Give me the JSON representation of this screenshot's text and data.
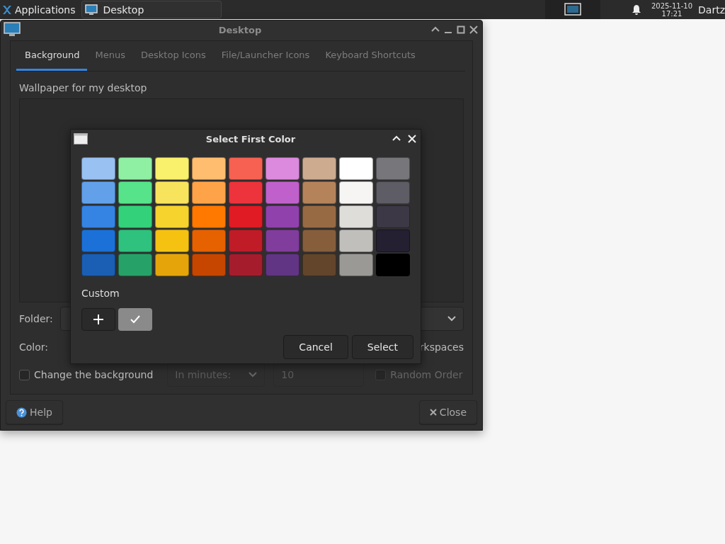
{
  "panel": {
    "menu_label": "Applications",
    "tasks": [
      {
        "label": "Desktop",
        "selected": true
      }
    ],
    "clock": {
      "date": "2025-11-10",
      "time": "17:21"
    },
    "user": "Dartz"
  },
  "window": {
    "title": "Desktop",
    "tabs": [
      {
        "label": "Background",
        "selected": true
      },
      {
        "label": "Menus",
        "selected": false
      },
      {
        "label": "Desktop Icons",
        "selected": false
      },
      {
        "label": "File/Launcher Icons",
        "selected": false
      },
      {
        "label": "Keyboard Shortcuts",
        "selected": false
      }
    ],
    "wallpaper_label": "Wallpaper for my desktop",
    "folder": {
      "label": "Folder:"
    },
    "color": {
      "label": "Color:",
      "apply_text": "rkspaces"
    },
    "change": {
      "label": "Change the background",
      "checked": false,
      "interval": "In minutes:",
      "minutes": "10",
      "random": {
        "label": "Random Order",
        "checked": false,
        "disabled": true
      }
    },
    "buttons": {
      "help": "Help",
      "close": "Close"
    }
  },
  "dialog": {
    "title": "Select First Color",
    "palette": [
      [
        {
          "color": "#99c1f1"
        },
        {
          "color": "#8ff0a4"
        },
        {
          "color": "#f9f06b"
        },
        {
          "color": "#ffbe6f"
        },
        {
          "color": "#f66151"
        },
        {
          "color": "#dc8add"
        },
        {
          "color": "#cdab8f"
        },
        {
          "color": "#ffffff"
        },
        {
          "color": "#77767b"
        }
      ],
      [
        {
          "color": "#62a0ea"
        },
        {
          "color": "#57e389"
        },
        {
          "color": "#f8e45c"
        },
        {
          "color": "#ffa348"
        },
        {
          "color": "#ed333b"
        },
        {
          "color": "#c061cb"
        },
        {
          "color": "#b5835a"
        },
        {
          "color": "#f6f5f4"
        },
        {
          "color": "#5e5c64"
        }
      ],
      [
        {
          "color": "#3584e4"
        },
        {
          "color": "#33d17a"
        },
        {
          "color": "#f6d32d"
        },
        {
          "color": "#ff7800"
        },
        {
          "color": "#e01b24"
        },
        {
          "color": "#9141ac"
        },
        {
          "color": "#986a44"
        },
        {
          "color": "#deddda"
        },
        {
          "color": "#3d3846"
        }
      ],
      [
        {
          "color": "#1c71d8"
        },
        {
          "color": "#2ec27e"
        },
        {
          "color": "#f5c211"
        },
        {
          "color": "#e66100"
        },
        {
          "color": "#c01c28"
        },
        {
          "color": "#813d9c"
        },
        {
          "color": "#865e3c"
        },
        {
          "color": "#c0bfbc"
        },
        {
          "color": "#241f31"
        }
      ],
      [
        {
          "color": "#1a5fb4"
        },
        {
          "color": "#26a269"
        },
        {
          "color": "#e5a50a"
        },
        {
          "color": "#c64600"
        },
        {
          "color": "#a51d2d"
        },
        {
          "color": "#613583"
        },
        {
          "color": "#63452c"
        },
        {
          "color": "#9a9996"
        },
        {
          "color": "#000000"
        }
      ]
    ],
    "custom_label": "Custom",
    "custom": [
      {
        "color": "#8a8a8a",
        "selected": true
      }
    ],
    "buttons": [
      "Cancel",
      "Select"
    ]
  }
}
